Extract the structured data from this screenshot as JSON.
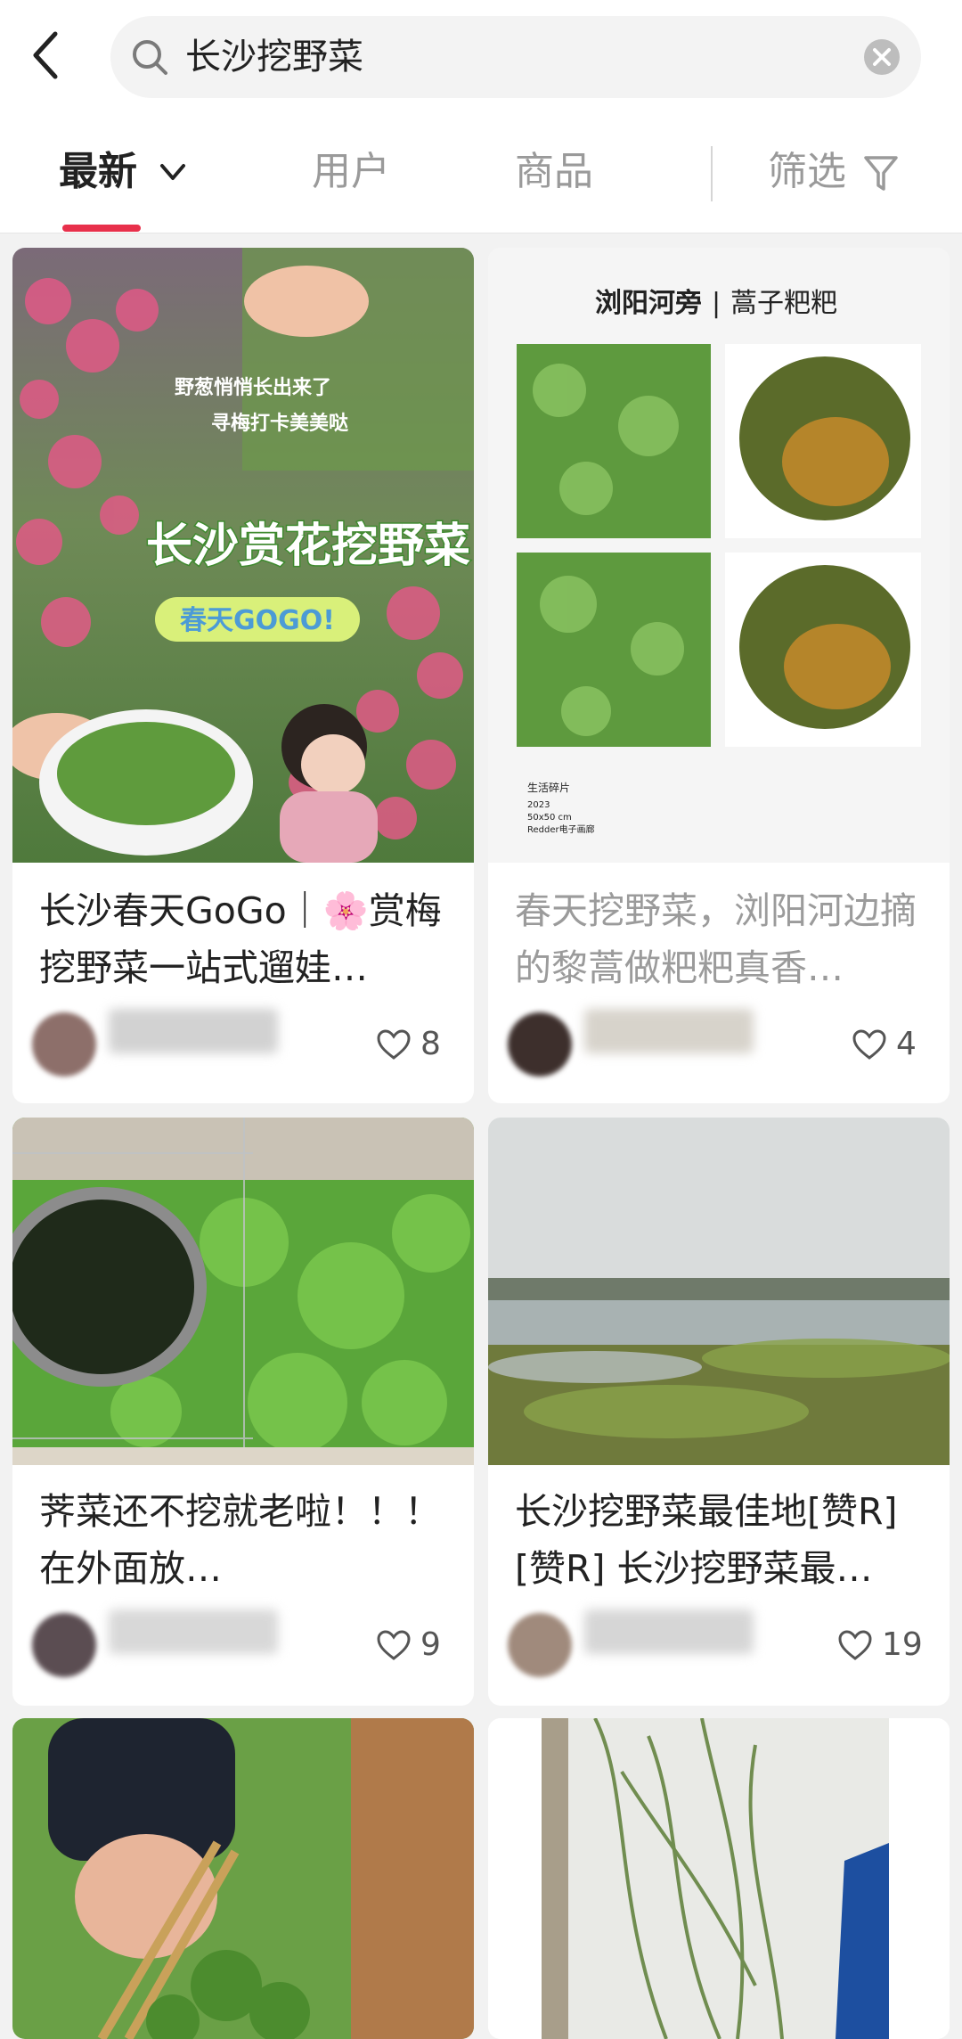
{
  "search": {
    "query": "长沙挖野菜"
  },
  "tabs": [
    {
      "label": "最新",
      "active": true
    },
    {
      "label": "用户",
      "active": false
    },
    {
      "label": "商品",
      "active": false
    },
    {
      "label": "筛选",
      "active": false
    }
  ],
  "colors": {
    "accent": "#e8304b",
    "background": "#f2f2f2"
  },
  "icons": {
    "back": "chevron-left-icon",
    "search": "search-icon",
    "clear": "clear-icon",
    "sort": "chevron-down-icon",
    "filter": "filter-icon",
    "like": "heart-icon"
  },
  "cards": [
    {
      "title": "长沙春天GoGo｜🌸赏梅挖野菜一站式遛娃…",
      "likes": "8",
      "image_text": {
        "line1": "野葱悄悄长出来了",
        "line2": "寻梅打卡美美哒",
        "headline": "长沙赏花挖野菜",
        "badge": "春天GOGO!"
      }
    },
    {
      "title": "春天挖野菜，浏阳河边摘的黎蒿做粑粑真香…",
      "likes": "4",
      "image_text": {
        "header_bold": "浏阳河旁",
        "header_sep": "|",
        "header_light": "蒿子粑粑",
        "caption_1": "生活碎片",
        "caption_2": "2023",
        "caption_3": "50x50 cm",
        "caption_4": "Redder电子画廊"
      }
    },
    {
      "title": "荠菜还不挖就老啦！！！ 在外面放…",
      "likes": "9"
    },
    {
      "title": "长沙挖野菜最佳地[赞R][赞R] 长沙挖野菜最…",
      "likes": "19"
    },
    {
      "title": ""
    },
    {
      "title": ""
    }
  ]
}
